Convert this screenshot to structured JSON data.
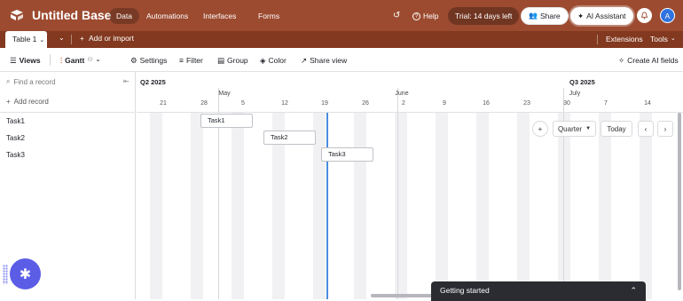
{
  "topbar": {
    "base_name": "Untitled Base",
    "nav": [
      "Data",
      "Automations",
      "Interfaces",
      "Forms"
    ],
    "help_label": "Help",
    "trial_label": "Trial: 14 days left",
    "share_label": "Share",
    "ai_label": "AI Assistant",
    "avatar_letter": "A",
    "colors": {
      "bar": "#9c4b30",
      "tabbar": "#82391f"
    }
  },
  "tabbar": {
    "table_tab": "Table 1",
    "add_import": "Add or import",
    "extensions": "Extensions",
    "tools": "Tools"
  },
  "viewbar": {
    "views": "Views",
    "gantt": "Gantt",
    "settings": "Settings",
    "filter": "Filter",
    "group": "Group",
    "color": "Color",
    "share_view": "Share view",
    "create_ai_fields": "Create AI fields"
  },
  "leftpanel": {
    "search_placeholder": "Find a record",
    "add_record": "Add record",
    "records": [
      "Task1",
      "Task2",
      "Task3"
    ]
  },
  "timeline": {
    "quarters": [
      "Q2 2025",
      "Q3 2025"
    ],
    "months": [
      "May",
      "June",
      "July"
    ],
    "days": [
      "21",
      "28",
      "5",
      "12",
      "19",
      "26",
      "2",
      "9",
      "16",
      "23",
      "30",
      "7",
      "14"
    ],
    "tasks": [
      {
        "label": "Task1",
        "row": 1
      },
      {
        "label": "Task2",
        "row": 2
      },
      {
        "label": "Task3",
        "row": 3
      }
    ],
    "zoom": "Quarter",
    "today": "Today",
    "today_color": "#4a8be0"
  },
  "overlays": {
    "getting_started": "Getting started"
  }
}
